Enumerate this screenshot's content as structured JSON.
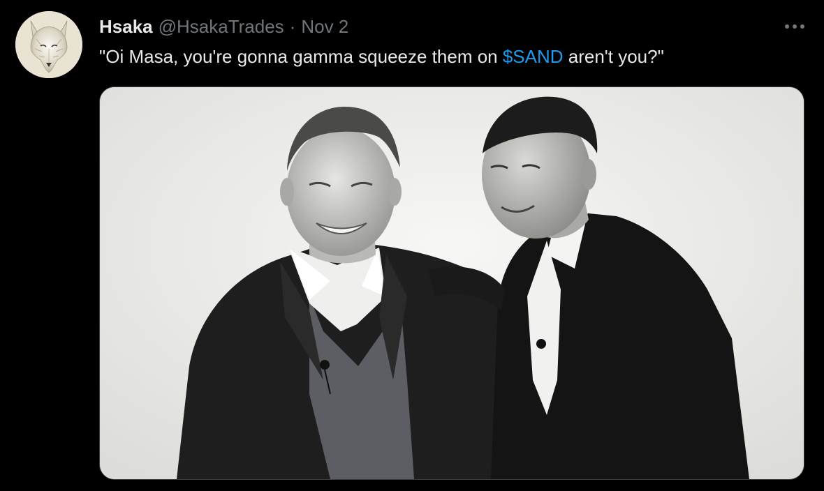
{
  "tweet": {
    "author": {
      "display_name": "Hsaka",
      "handle": "@HsakaTrades",
      "avatar_icon": "white-wolf-avatar-icon"
    },
    "separator": "·",
    "date": "Nov 2",
    "more_icon": "more-options-icon",
    "text": {
      "before": "\"Oi Masa, you're gonna gamma squeeze them on ",
      "cashtag": "$SAND",
      "after": " aren't you?\""
    },
    "media": {
      "type": "photo"
    }
  },
  "colors": {
    "background": "#000000",
    "primary_text": "#e7e9ea",
    "secondary_text": "#71767b",
    "link": "#1d9bf0",
    "media_border": "#3a3d40"
  }
}
